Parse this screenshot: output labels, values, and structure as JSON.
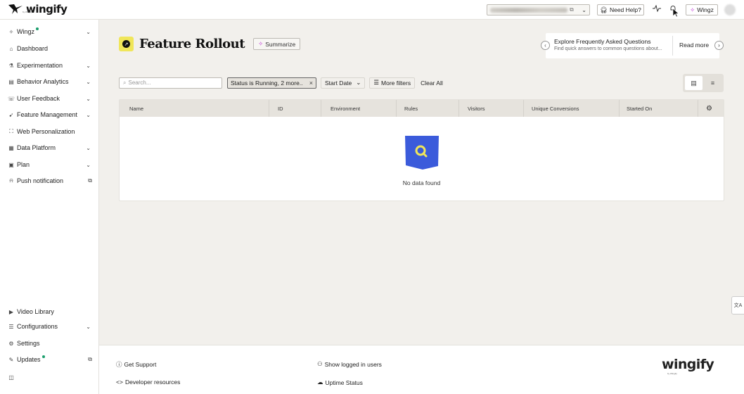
{
  "brand": {
    "name": "wingify",
    "sub": "by Wingify"
  },
  "topbar": {
    "workspace_copy_icon": "copy-icon",
    "help_label": "Need Help?",
    "wingz_label": "Wingz"
  },
  "sidebar": {
    "items": [
      {
        "label": "Wingz",
        "icon": "sparkle-icon",
        "dot": true,
        "chevron": true
      },
      {
        "label": "Dashboard",
        "icon": "home-icon"
      },
      {
        "label": "Experimentation",
        "icon": "flask-icon",
        "chevron": true
      },
      {
        "label": "Behavior Analytics",
        "icon": "analytics-icon",
        "chevron": true
      },
      {
        "label": "User Feedback",
        "icon": "feedback-icon",
        "chevron": true
      },
      {
        "label": "Feature Management",
        "icon": "rocket-icon",
        "chevron": true
      },
      {
        "label": "Web Personalization",
        "icon": "personalize-icon"
      },
      {
        "label": "Data Platform",
        "icon": "database-icon",
        "chevron": true
      },
      {
        "label": "Plan",
        "icon": "calendar-icon",
        "chevron": true
      },
      {
        "label": "Push notification",
        "icon": "bell-icon",
        "external": true
      }
    ],
    "bottom_items": [
      {
        "label": "Video Library",
        "icon": "video-icon"
      },
      {
        "label": "Configurations",
        "icon": "sliders-icon",
        "chevron": true
      },
      {
        "label": "Settings",
        "icon": "gear-icon"
      },
      {
        "label": "Updates",
        "icon": "megaphone-icon",
        "dot": true,
        "external": true
      }
    ]
  },
  "page": {
    "title": "Feature Rollout",
    "summarize_label": "Summarize"
  },
  "faq": {
    "title": "Explore Frequently Asked Questions",
    "subtitle": "Find quick answers to common questions about...",
    "read_more": "Read more"
  },
  "filters": {
    "search_placeholder": "Search...",
    "status_chip": "Status is Running,  2 more..",
    "start_date": "Start Date",
    "more_filters": "More filters",
    "clear_all": "Clear All"
  },
  "table": {
    "columns": [
      "Name",
      "ID",
      "Environment",
      "Rules",
      "Visitors",
      "Unique Conversions",
      "Started On"
    ],
    "empty_text": "No data found"
  },
  "footer": {
    "get_support": "Get Support",
    "developer_resources": "Developer resources",
    "show_logged_in": "Show logged in users",
    "uptime_status": "Uptime Status",
    "logo": "wingify",
    "logo_sub": "by Wingify"
  },
  "colors": {
    "accent_yellow": "#f0e65a",
    "illus_blue": "#3b5bdb",
    "dot_green": "#1a9e6c",
    "page_bg": "#f2f0ec"
  }
}
